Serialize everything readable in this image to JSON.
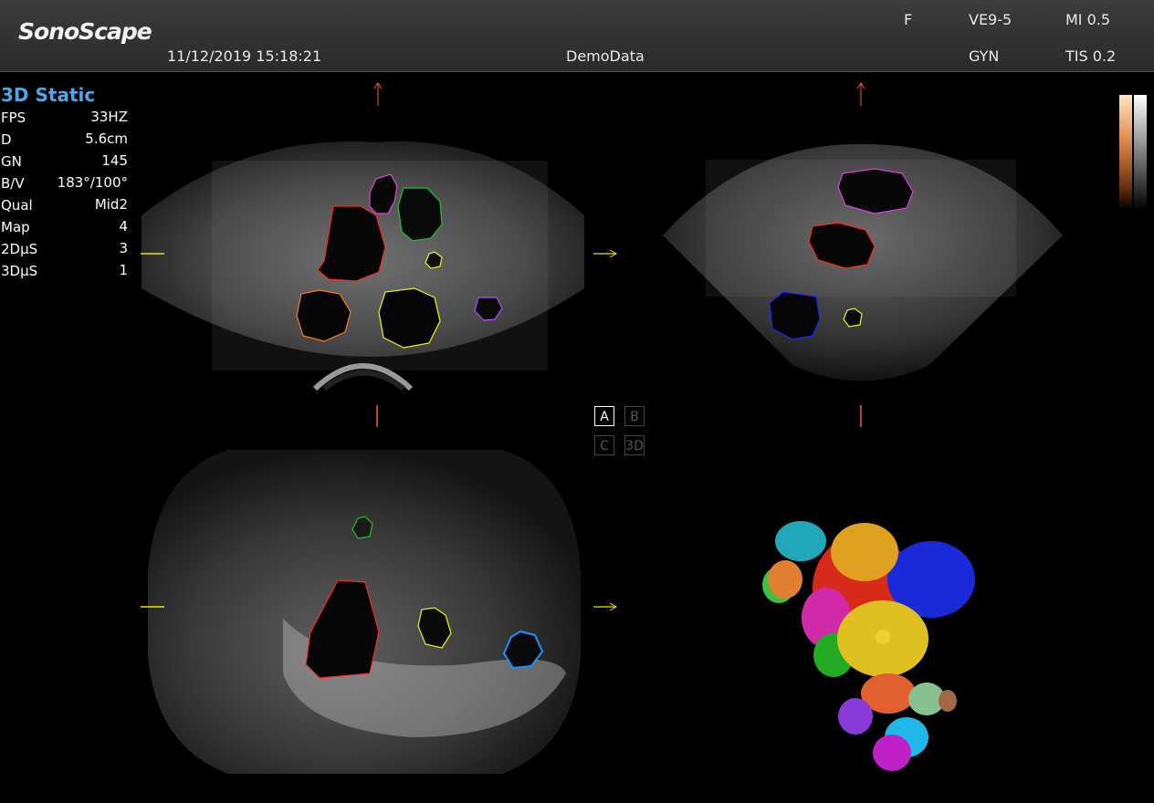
{
  "header": {
    "brand": "SonoScape",
    "datetime": "11/12/2019 15:18:21",
    "patient": "DemoData",
    "freq": "F",
    "probe": "VE9-5",
    "preset": "GYN",
    "mi": "MI 0.5",
    "tis": "TIS 0.2"
  },
  "mode_title": "3D Static",
  "params": [
    {
      "label": "FPS",
      "value": "33HZ"
    },
    {
      "label": "D",
      "value": "5.6cm"
    },
    {
      "label": "GN",
      "value": "145"
    },
    {
      "label": "B/V",
      "value": "183°/100°"
    },
    {
      "label": "Qual",
      "value": "Mid2"
    },
    {
      "label": "Map",
      "value": "4"
    },
    {
      "label": "2DμS",
      "value": "3"
    },
    {
      "label": "3DμS",
      "value": "1"
    }
  ],
  "quad_buttons": {
    "a": "A",
    "b": "B",
    "c": "C",
    "d": "3D",
    "active": "A"
  },
  "colors": {
    "mode_title": "#4da6e6",
    "red_outline": "#ff2a1a",
    "yellow_outline": "#f5f500",
    "orange_outline": "#ff7a1a",
    "magenta_outline": "#e040e0",
    "green_outline": "#22c422",
    "blue_outline": "#2222ff",
    "light_blue_outline": "#1e90ff",
    "violet_outline": "#b44dff"
  }
}
